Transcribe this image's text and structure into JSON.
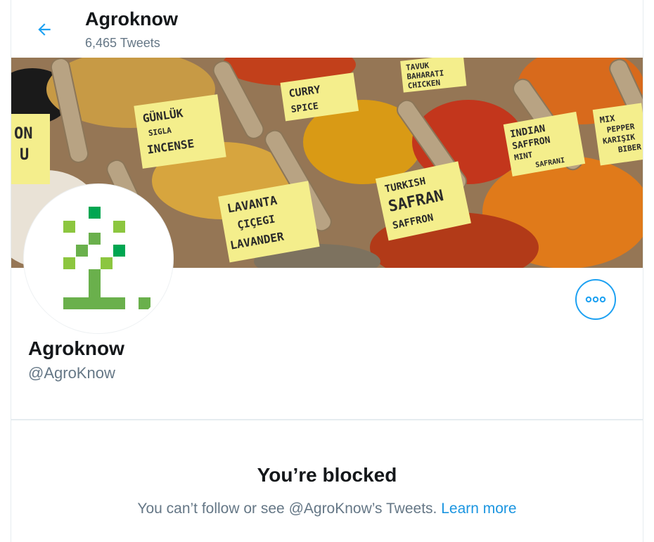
{
  "header": {
    "title": "Agroknow",
    "tweet_count": "6,465 Tweets"
  },
  "banner": {
    "labels": {
      "gunluk": [
        "GÜNLÜK",
        "SIGLA",
        "INCENSE"
      ],
      "curry": [
        "CURRY",
        "SPICE"
      ],
      "tavuk": [
        "TAVUK",
        "BAHARATI",
        "CHICKEN"
      ],
      "indian": [
        "INDIAN",
        "SAFFRON",
        "MINT",
        "SAFRANI"
      ],
      "mix": [
        "MIX",
        "PEPPER",
        "KARIŞIK",
        "BIBER"
      ],
      "lavanta": [
        "LAVANTA",
        "ÇIÇEGI",
        "LAVANDER"
      ],
      "turkish": [
        "TURKISH",
        "SAFRAN",
        "SAFFRON"
      ],
      "left": [
        "ON",
        "U"
      ]
    }
  },
  "profile": {
    "name": "Agroknow",
    "handle": "@AgroKnow"
  },
  "blocked": {
    "title": "You’re blocked",
    "message": "You can’t follow or see @AgroKnow’s Tweets.",
    "link": "Learn more"
  },
  "colors": {
    "accent": "#1da1f2",
    "link": "#1b95e0",
    "logo_light_green": "#8cc63f",
    "logo_dark_green": "#00a651",
    "logo_mid_green": "#6ab04c"
  },
  "icons": {
    "back": "arrow-left-icon",
    "more": "more-horizontal-icon"
  }
}
